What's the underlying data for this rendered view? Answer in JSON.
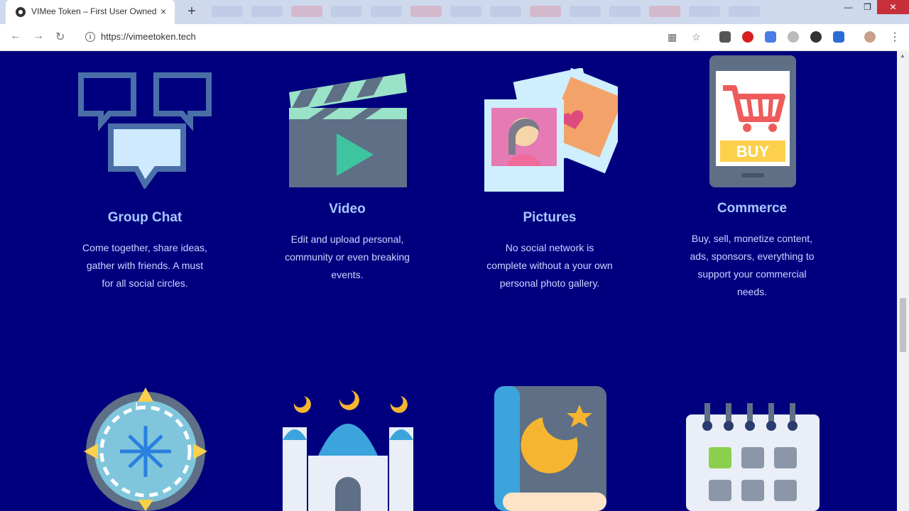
{
  "browser": {
    "tab_title": "VIMee Token – First User Owned",
    "tab_close": "×",
    "new_tab": "+",
    "window": {
      "minimize": "—",
      "restore": "❐",
      "close": "✕"
    },
    "url": "https://vimeetoken.tech"
  },
  "features": [
    {
      "title": "Group Chat",
      "description": "Come together, share ideas, gather with friends. A must for all social circles."
    },
    {
      "title": "Video",
      "description": "Edit and upload personal, community or even breaking events."
    },
    {
      "title": "Pictures",
      "description": "No social network is complete without a your own personal photo gallery."
    },
    {
      "title": "Commerce",
      "description": "Buy, sell, monetize content, ads, sponsors, everything to support your commercial needs."
    }
  ],
  "commerce_icon_text": "BUY",
  "colors": {
    "page_bg": "#00007f",
    "title": "#a8c8ff",
    "text": "#ccd6ff"
  }
}
